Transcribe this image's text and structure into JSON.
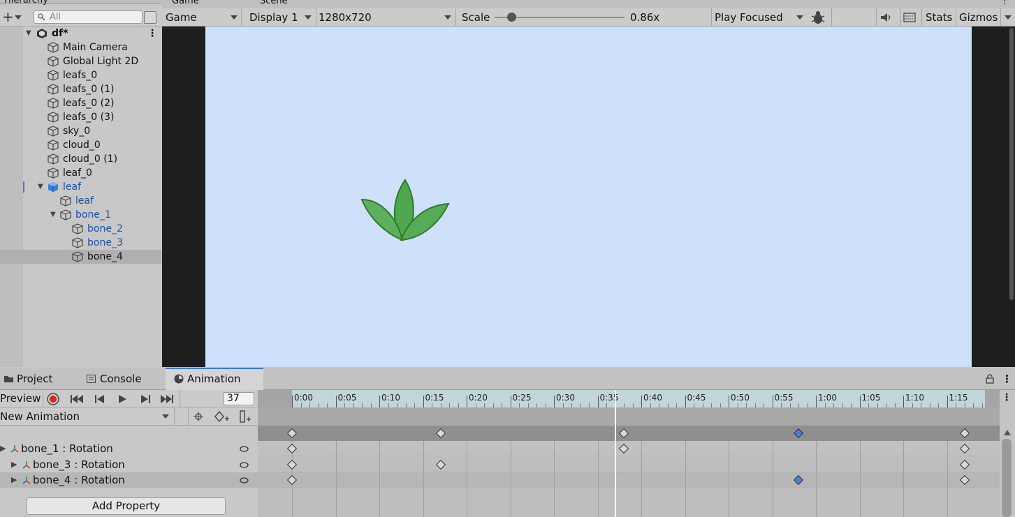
{
  "hierarchy": {
    "tab_label": "Hierarchy",
    "search_placeholder": "All",
    "scene_name": "df*",
    "items": [
      {
        "label": "Main Camera"
      },
      {
        "label": "Global Light 2D"
      },
      {
        "label": "leafs_0"
      },
      {
        "label": "leafs_0 (1)"
      },
      {
        "label": "leafs_0 (2)"
      },
      {
        "label": "leafs_0 (3)"
      },
      {
        "label": "sky_0"
      },
      {
        "label": "cloud_0"
      },
      {
        "label": "cloud_0 (1)"
      },
      {
        "label": "leaf_0"
      },
      {
        "label": "leaf"
      },
      {
        "label": "leaf"
      },
      {
        "label": "bone_1"
      },
      {
        "label": "bone_2"
      },
      {
        "label": "bone_3"
      },
      {
        "label": "bone_4"
      }
    ]
  },
  "top_tabs": {
    "game": "Game",
    "scene": "Scene"
  },
  "game_toolbar": {
    "view": "Game",
    "display": "Display 1",
    "resolution": "1280x720",
    "scale_label": "Scale",
    "scale_value": "0.86x",
    "scale_fraction": 0.13,
    "play_mode": "Play Focused",
    "stats": "Stats",
    "gizmos": "Gizmos"
  },
  "bottom_tabs": {
    "project": "Project",
    "console": "Console",
    "animation": "Animation"
  },
  "animation": {
    "preview": "Preview",
    "frame": "37",
    "clip": "New Animation",
    "add_property": "Add Property",
    "properties": [
      {
        "label": "bone_1 : Rotation"
      },
      {
        "label": "bone_3 : Rotation"
      },
      {
        "label": "bone_4 : Rotation"
      }
    ],
    "ticks": [
      "0:00",
      "0:05",
      "0:10",
      "0:15",
      "0:20",
      "0:25",
      "0:30",
      "0:35",
      "0:40",
      "0:45",
      "0:50",
      "0:55",
      "1:00",
      "1:05",
      "1:10",
      "1:15"
    ],
    "playhead_frame": 37
  },
  "colors": {
    "canvas": "#cfe0fb",
    "leaf": "#3d9a3d",
    "selected_key": "#4a7fd6",
    "accent": "#3a7bd5"
  }
}
